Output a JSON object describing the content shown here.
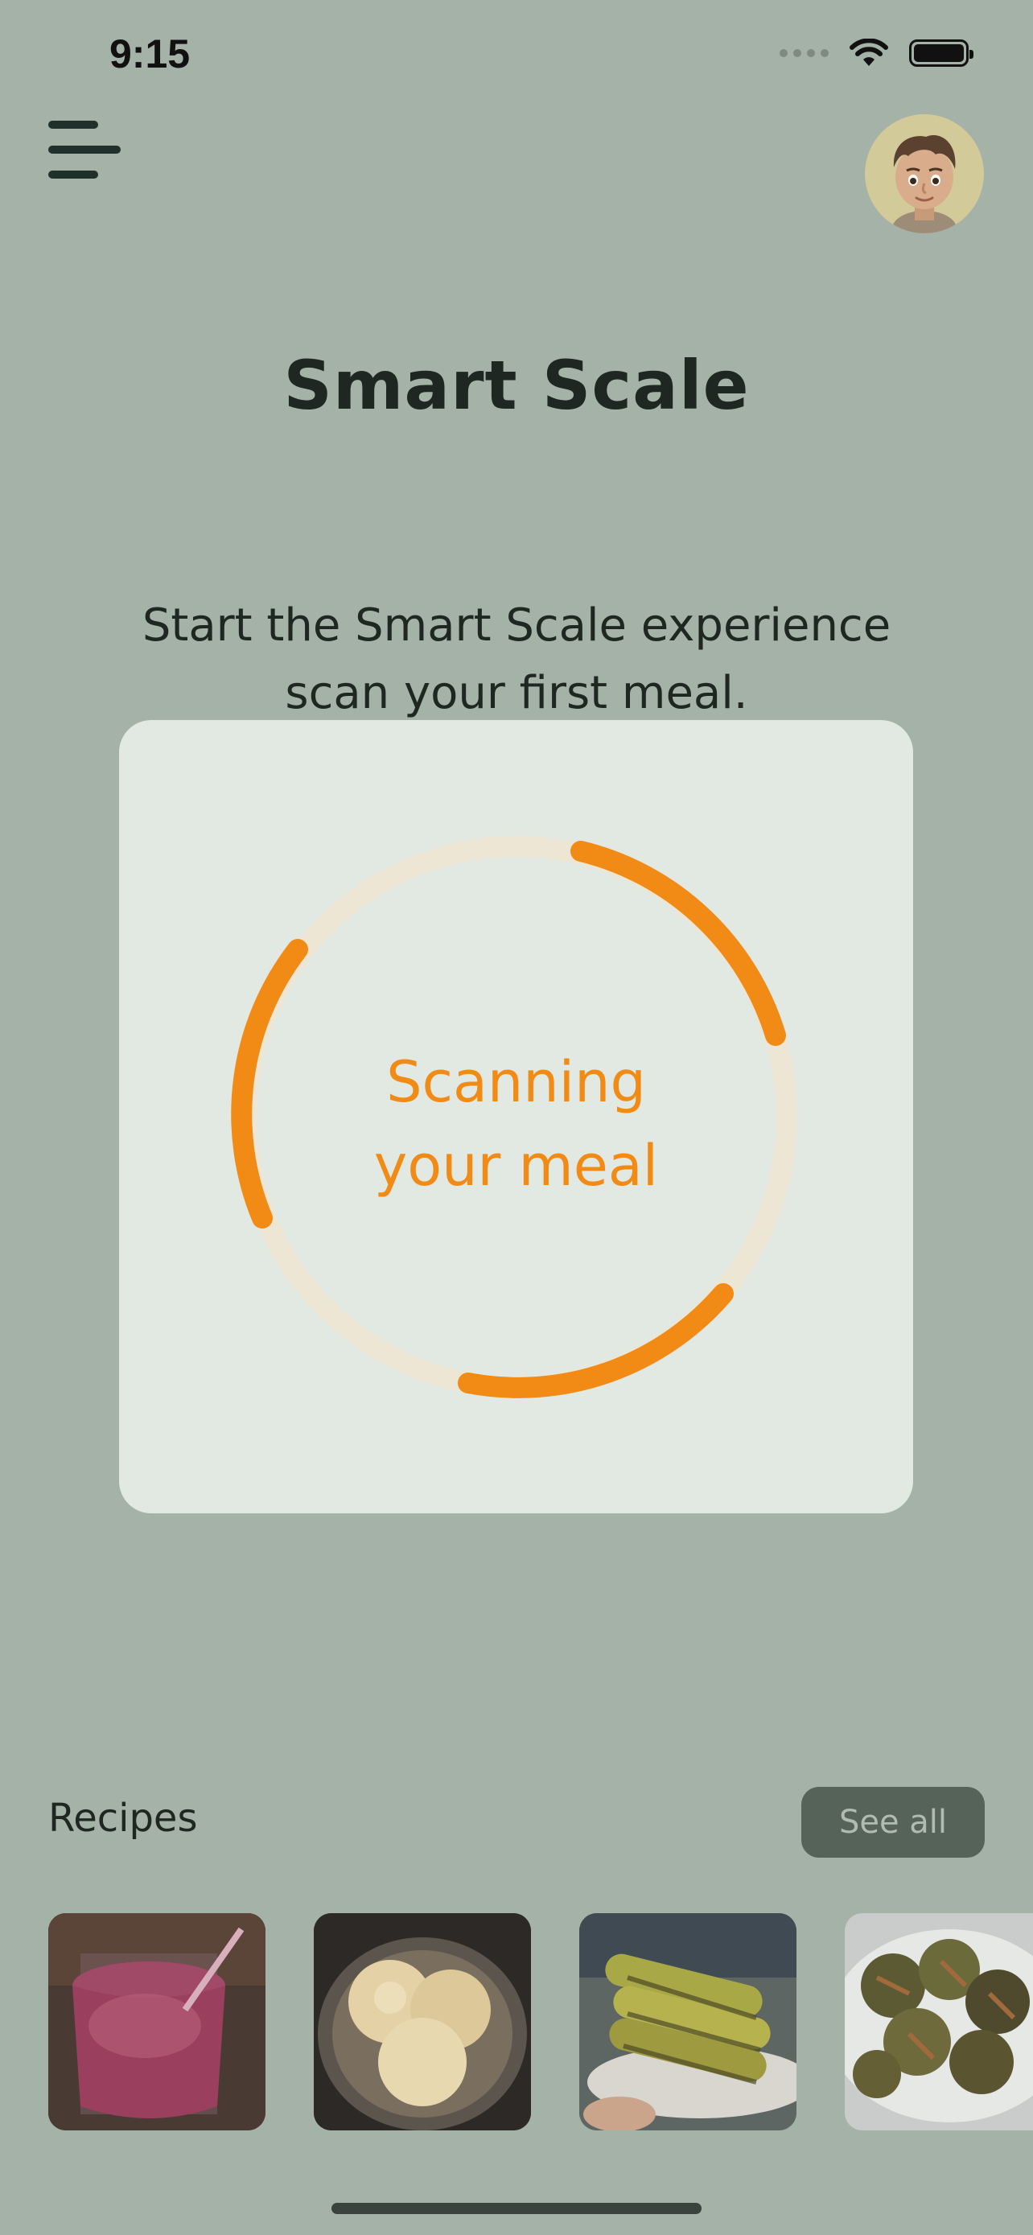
{
  "status_bar": {
    "time": "9:15"
  },
  "header": {
    "menu_icon": "hamburger-menu-icon",
    "avatar": "memoji-avatar"
  },
  "page": {
    "title": "Smart Scale",
    "subtitle_line1": "Start the Smart Scale experience",
    "subtitle_line2": "scan your first meal."
  },
  "scanner": {
    "status_line1": "Scanning",
    "status_line2": "your meal",
    "accent_color": "#f18b16",
    "track_color": "#ede6d5"
  },
  "recipes": {
    "title": "Recipes",
    "see_all_label": "See all",
    "items": [
      {
        "image": "berry-smoothie"
      },
      {
        "image": "vanilla-ice-cream"
      },
      {
        "image": "grilled-corn"
      },
      {
        "image": "roasted-artichokes"
      }
    ]
  },
  "colors": {
    "background": "#a5b2a7",
    "card": "#e2e9e3",
    "button": "#566359",
    "text": "#1e2722"
  }
}
